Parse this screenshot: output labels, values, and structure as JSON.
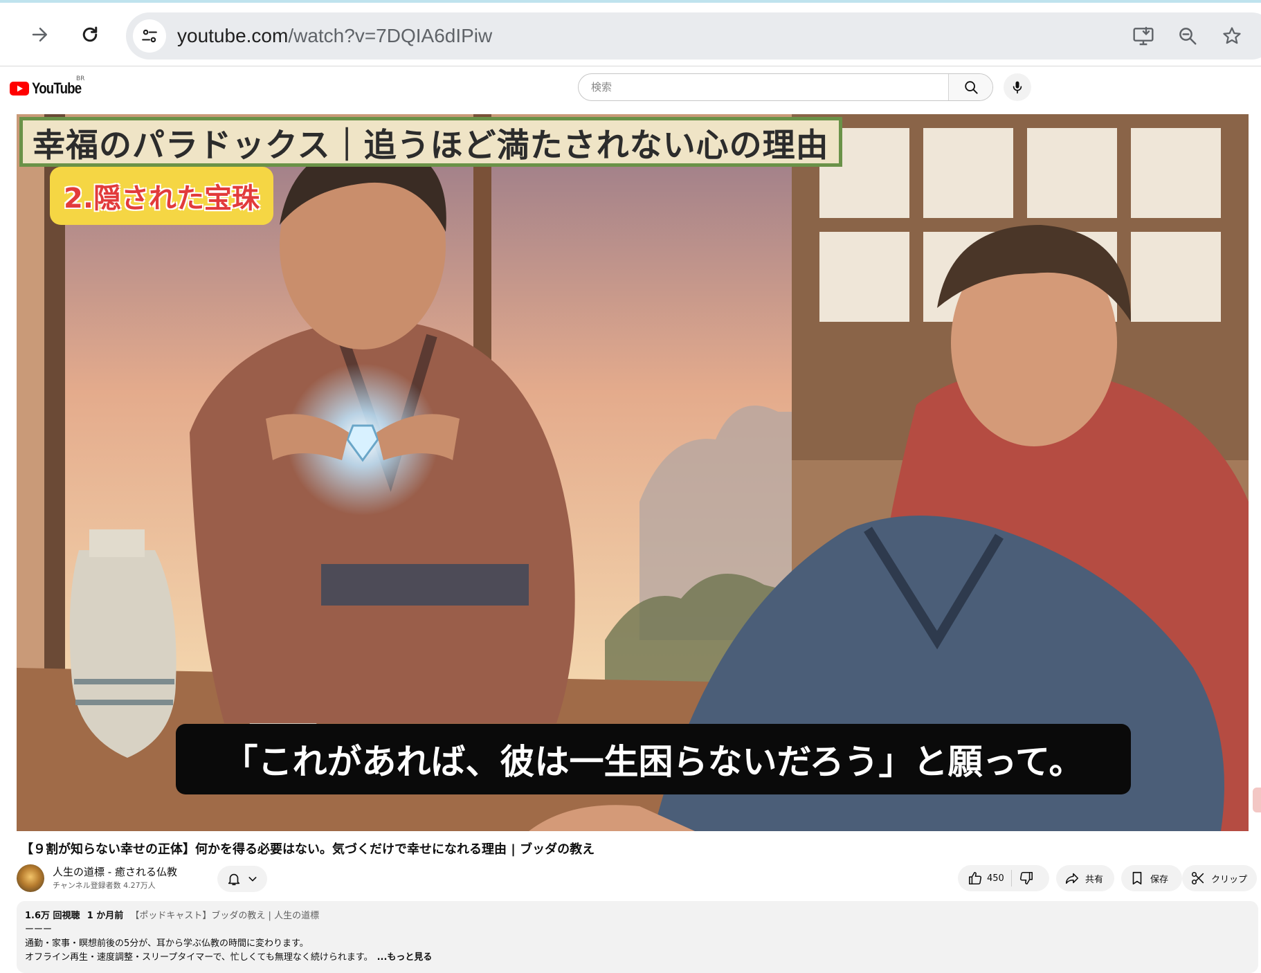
{
  "browser": {
    "url_host": "youtube.com",
    "url_path": "/watch?v=7DQIA6dIPiw"
  },
  "masthead": {
    "logo_text": "YouTube",
    "region": "BR",
    "search_placeholder": "検索"
  },
  "player": {
    "title_banner": "幸福のパラドックス｜追うほど満たされない心の理由",
    "chapter_label": "2.隠された宝珠",
    "subtitle": "「これがあれば、彼は一生困らないだろう」と願って。"
  },
  "video": {
    "title": "【９割が知らない幸せの正体】何かを得る必要はない。気づくだけで幸せになれる理由 | ブッダの教え",
    "channel_name": "人生の道標 - 癒される仏教",
    "subscribers": "チャンネル登録者数 4.27万人",
    "likes": "450",
    "share_label": "共有",
    "save_label": "保存",
    "clip_label": "クリップ"
  },
  "description": {
    "views": "1.6万 回視聴",
    "age": "1 か月前",
    "tags": "【ポッドキャスト】ブッダの教え | 人生の道標",
    "divider": "ーーー",
    "line1": "通勤・家事・瞑想前後の5分が、耳から学ぶ仏教の時間に変わります。",
    "line2": "オフライン再生・速度調整・スリープタイマーで、忙しくても無理なく続けられます。",
    "more_label": "...もっと見る"
  },
  "icons": {
    "forward": "arrow-forward-icon",
    "reload": "reload-icon",
    "site_info": "tune-icon",
    "install": "install-app-icon",
    "zoom": "zoom-icon",
    "bookmark": "star-icon",
    "search": "search-icon",
    "mic": "mic-icon",
    "bell": "bell-icon",
    "like": "thumb-up-icon",
    "dislike": "thumb-down-icon",
    "share": "share-icon",
    "save": "bookmark-icon",
    "clip": "scissors-icon"
  },
  "colors": {
    "youtube_red": "#ff0000",
    "banner_border": "#6a9248",
    "chapter_bg": "#f5d644",
    "chapter_text": "#e23b3b"
  }
}
